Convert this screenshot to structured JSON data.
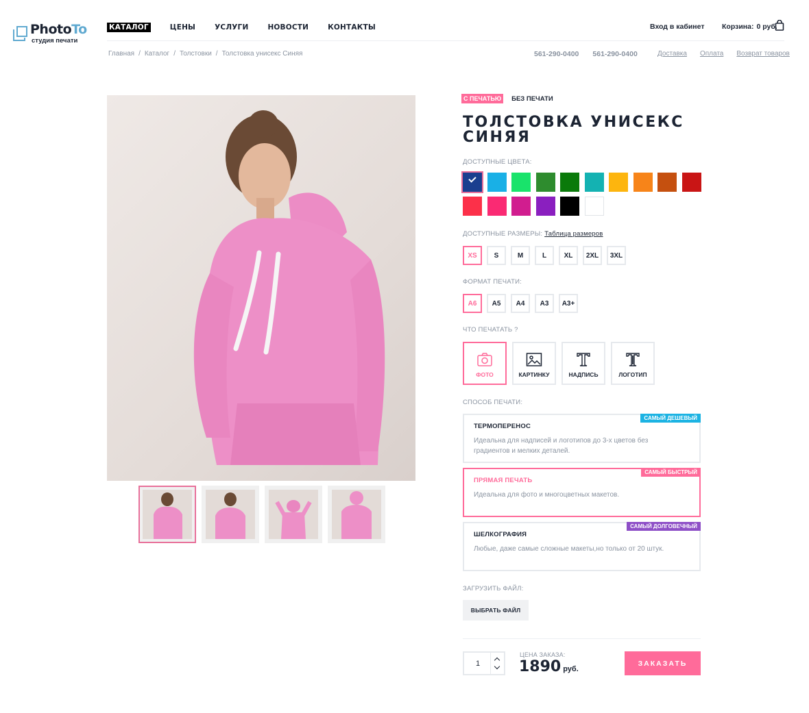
{
  "brand": {
    "name_a": "Photo",
    "name_b": "To",
    "tagline": "студия печати"
  },
  "nav": [
    {
      "label": "КАТАЛОГ",
      "active": true
    },
    {
      "label": "ЦЕНЫ"
    },
    {
      "label": "УСЛУГИ"
    },
    {
      "label": "НОВОСТИ"
    },
    {
      "label": "КОНТАКТЫ"
    }
  ],
  "header": {
    "login": "Вход в кабинет",
    "cart_label": "Корзина:",
    "cart_value": "0 руб."
  },
  "breadcrumb": [
    "Главная",
    "Каталог",
    "Толстовки",
    "Толстовка унисекс Синяя"
  ],
  "phones": [
    "561-290-0400",
    "561-290-0400"
  ],
  "toplinks": [
    "Доставка",
    "Оплата",
    "Возврат товаров"
  ],
  "product": {
    "tab_print": "С ПЕЧАТЬЮ",
    "tab_noprint": "БЕЗ ПЕЧАТИ",
    "title": "ТОЛСТОВКА УНИСЕКС СИНЯЯ",
    "colors_label": "ДОСТУПНЫЕ  ЦВЕТА:",
    "colors": [
      "#1a3f8f",
      "#19b0e6",
      "#19e36b",
      "#2e8c2e",
      "#0a7a0a",
      "#14b2b2",
      "#fdb50e",
      "#f78419",
      "#c5500f",
      "#c91515",
      "#fc3049",
      "#fa2a73",
      "#d11d8f",
      "#8a1fbf",
      "#000000",
      "#ffffff"
    ],
    "selected_color_index": 0,
    "sizes_label": "ДОСТУПНЫЕ РАЗМЕРЫ:",
    "sizes_link": "Таблица размеров",
    "sizes": [
      "XS",
      "S",
      "M",
      "L",
      "XL",
      "2XL",
      "3XL"
    ],
    "selected_size": "XS",
    "format_label": "ФОРМАТ ПЕЧАТИ:",
    "formats": [
      "A6",
      "A5",
      "A4",
      "A3",
      "A3+"
    ],
    "selected_format": "A6",
    "what_label": "ЧТО ПЕЧАТАТЬ ?",
    "what": [
      {
        "label": "ФОТО",
        "icon": "camera-icon",
        "selected": true
      },
      {
        "label": "КАРТИНКУ",
        "icon": "image-icon"
      },
      {
        "label": "НАДПИСЬ",
        "icon": "text-icon"
      },
      {
        "label": "ЛОГОТИП",
        "icon": "logo-icon"
      }
    ],
    "method_label": "СПОСОБ ПЕЧАТИ:",
    "methods": [
      {
        "title": "ТЕРМОПЕРЕНОС",
        "desc": "Идеальна для надписей и логотипов до 3-х цветов без градиентов и мелких деталей.",
        "badge": "САМЫЙ ДЕШЕВЫЙ",
        "badge_color": "#1cb3e3"
      },
      {
        "title": "ПРЯМАЯ ПЕЧАТЬ",
        "desc": "Идеальна для фото и многоцветных макетов.",
        "badge": "САМЫЙ БЫСТРЫЙ",
        "badge_color": "#ff6b9a",
        "selected": true
      },
      {
        "title": "ШЕЛКОГРАФИЯ",
        "desc": "Любые, даже самые сложные макеты,но только от 20 штук.",
        "badge": "САМЫЙ  ДОЛГОВЕЧНЫЙ",
        "badge_color": "#8e4fc7"
      }
    ],
    "upload_label": "ЗАГРУЗИТЬ ФАЙЛ:",
    "upload_button": "ВЫБРАТЬ ФАЙЛ",
    "quantity": "1",
    "price_label": "ЦЕНА ЗАКАЗА:",
    "price": "1890",
    "currency": "руб.",
    "order_button": "ЗАКАЗАТЬ"
  },
  "colors": {
    "accent": "#ff6b9a",
    "hoodie": "#ed8fc7",
    "text": "#1c2433",
    "muted": "#8a93a0"
  }
}
